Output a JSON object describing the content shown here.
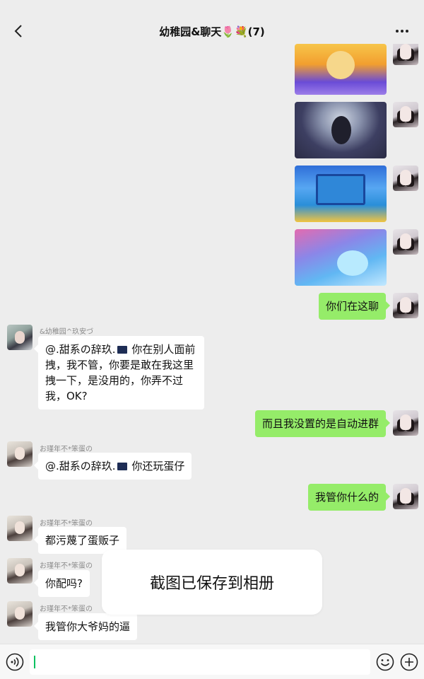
{
  "header": {
    "title": "幼稚园&聊天",
    "title_emoji": "🌷💐",
    "member_count": "(7)",
    "back_icon": "chevron-left-icon",
    "more_icon": "more-horizontal-icon"
  },
  "messages": [
    {
      "type": "image",
      "from": "me",
      "kind": "game-screenshot-victory"
    },
    {
      "type": "image",
      "from": "me",
      "kind": "game-screenshot-stage"
    },
    {
      "type": "image",
      "from": "me",
      "kind": "game-screenshot-laptop"
    },
    {
      "type": "image",
      "from": "me",
      "kind": "game-screenshot-map"
    },
    {
      "type": "text",
      "from": "me",
      "text": "你们在这聊"
    },
    {
      "type": "text",
      "from": "other",
      "sender": "&幼稚园^玖安づ",
      "text_lines": [
        "@.甜系の辞玖.",
        " 你在别人面前",
        "拽，我不管，你要是敢在我这里",
        "拽一下，是没用的，你弄不过",
        "我，OK?"
      ]
    },
    {
      "type": "text",
      "from": "me",
      "text": "而且我没置的是自动进群"
    },
    {
      "type": "text",
      "from": "other",
      "sender": "お瑾年不*笨蛋の",
      "text_parts": [
        "@.甜系の辞玖.",
        " 你还玩蛋仔"
      ]
    },
    {
      "type": "text",
      "from": "me",
      "text": "我管你什么的"
    },
    {
      "type": "text",
      "from": "other",
      "sender": "お瑾年不*笨蛋の",
      "text": "都污蔑了蛋贩子"
    },
    {
      "type": "text",
      "from": "other",
      "sender": "お瑾年不*笨蛋の",
      "text": "你配吗?"
    },
    {
      "type": "text",
      "from": "other",
      "sender": "お瑾年不*笨蛋の",
      "text": "我管你大爷妈的逼"
    }
  ],
  "toast": {
    "text": "截图已保存到相册"
  },
  "input_bar": {
    "voice_icon": "voice-icon",
    "emoji_icon": "emoji-icon",
    "plus_icon": "plus-icon",
    "input_value": ""
  },
  "colors": {
    "background": "#ededed",
    "my_bubble": "#95ec69",
    "other_bubble": "#ffffff",
    "caret": "#07c160"
  }
}
